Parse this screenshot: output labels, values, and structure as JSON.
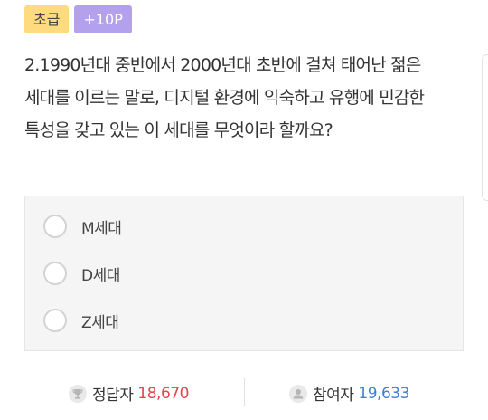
{
  "badges": {
    "level": "초급",
    "points": "+10P"
  },
  "question": "2.1990년대 중반에서 2000년대 초반에 걸쳐 태어난 젊은 세대를 이르는 말로, 디지털 환경에 익숙하고 유행에 민감한 특성을 갖고 있는 이 세대를 무엇이라 할까요?",
  "options": [
    {
      "label": "M세대"
    },
    {
      "label": "D세대"
    },
    {
      "label": "Z세대"
    }
  ],
  "stats": {
    "correct_label": "정답자",
    "correct_value": "18,670",
    "correct_icon": "trophy-icon",
    "participants_label": "참여자",
    "participants_value": "19,633",
    "participants_icon": "user-icon"
  },
  "colors": {
    "level_badge": "#fddb7e",
    "points_badge": "#b4a1ee",
    "correct_value": "#e0474c",
    "participants_value": "#3d80d9"
  }
}
